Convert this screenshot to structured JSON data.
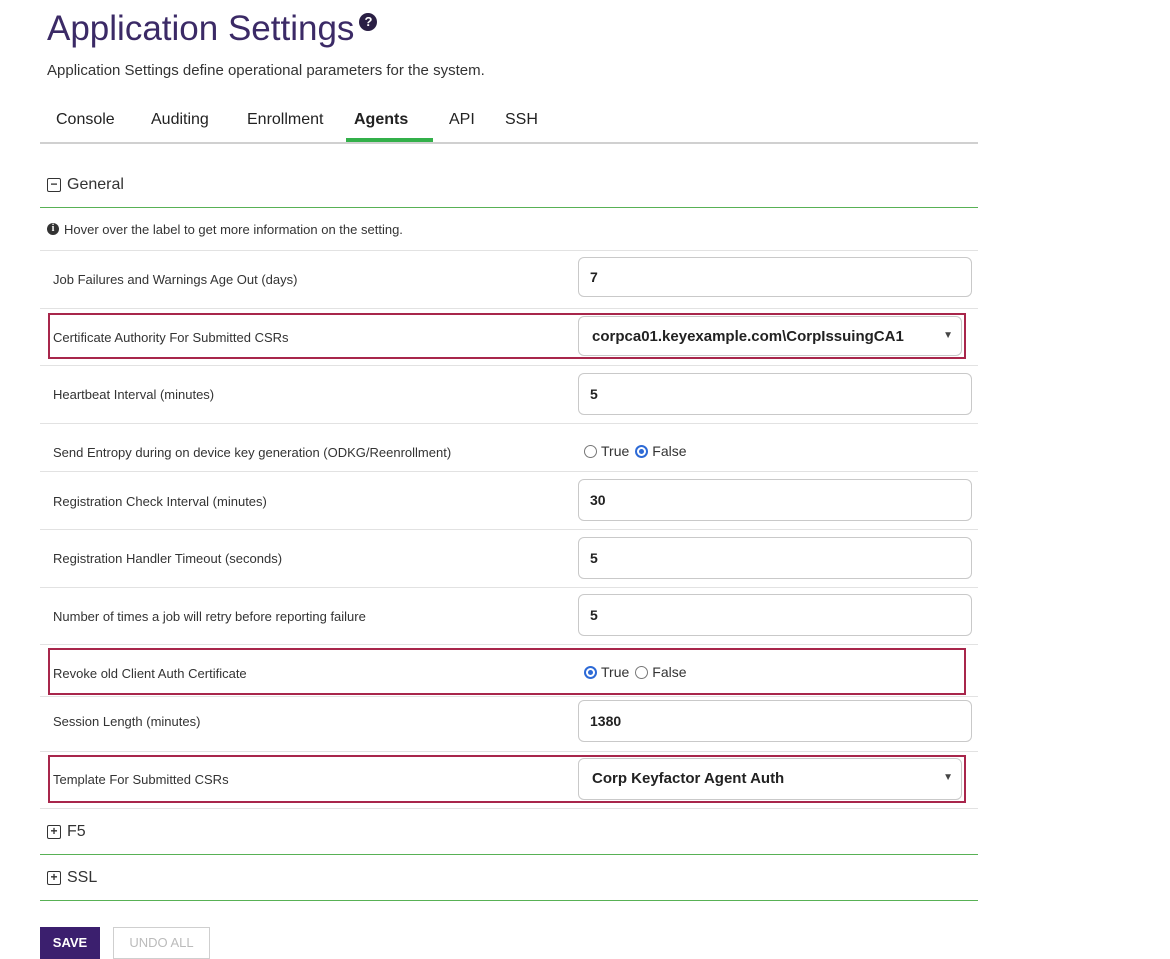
{
  "header": {
    "title": "Application Settings",
    "subtitle": "Application Settings define operational parameters for the system."
  },
  "tabs": [
    {
      "label": "Console"
    },
    {
      "label": "Auditing"
    },
    {
      "label": "Enrollment"
    },
    {
      "label": "Agents",
      "active": true
    },
    {
      "label": "API"
    },
    {
      "label": "SSH"
    }
  ],
  "sections": {
    "general": {
      "label": "General",
      "icon": "minus-square-icon"
    },
    "f5": {
      "label": "F5",
      "icon": "plus-square-icon"
    },
    "ssl": {
      "label": "SSL",
      "icon": "plus-square-icon"
    }
  },
  "info_text": "Hover over the label to get more information on the setting.",
  "settings": [
    {
      "label": "Job Failures and Warnings Age Out (days)",
      "value": "7"
    },
    {
      "label": "Certificate Authority For Submitted CSRs",
      "value": "corpca01.keyexample.com\\CorpIssuingCA1"
    },
    {
      "label": "Heartbeat Interval (minutes)",
      "value": "5"
    },
    {
      "label": "Send Entropy during on device key generation (ODKG/Reenrollment)",
      "true_label": "True",
      "false_label": "False",
      "selected": "False"
    },
    {
      "label": "Registration Check Interval (minutes)",
      "value": "30"
    },
    {
      "label": "Registration Handler Timeout (seconds)",
      "value": "5"
    },
    {
      "label": "Number of times a job will retry before reporting failure",
      "value": "5"
    },
    {
      "label": "Revoke old Client Auth Certificate",
      "true_label": "True",
      "false_label": "False",
      "selected": "True"
    },
    {
      "label": "Session Length (minutes)",
      "value": "1380"
    },
    {
      "label": "Template For Submitted CSRs",
      "value": "Corp Keyfactor Agent Auth"
    }
  ],
  "buttons": {
    "save": "SAVE",
    "undo_all": "UNDO ALL"
  },
  "colors": {
    "title": "#3b2a66",
    "accent_green": "#33b04a",
    "highlight": "#a8264b",
    "save_button": "#3b1f6e",
    "radio": "#2d6ad6"
  }
}
